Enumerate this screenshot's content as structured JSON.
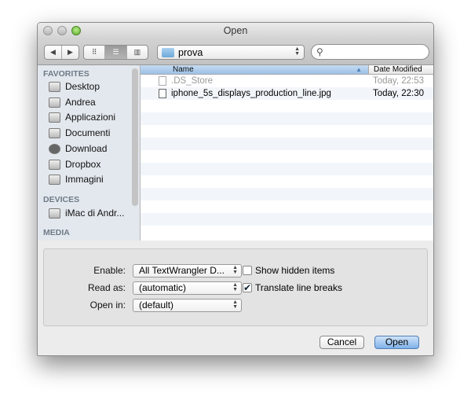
{
  "window": {
    "title": "Open"
  },
  "toolbar": {
    "back": "◀",
    "forward": "▶",
    "view_icon": "⠿",
    "view_list": "☰",
    "view_column": "▥",
    "path": "prova",
    "search_placeholder": "",
    "search_icon": "magnifier"
  },
  "sidebar": {
    "favorites_header": "FAVORITES",
    "favorites": [
      {
        "label": "Desktop",
        "icon": "desktop-icon"
      },
      {
        "label": "Andrea",
        "icon": "home-icon"
      },
      {
        "label": "Applicazioni",
        "icon": "applications-icon"
      },
      {
        "label": "Documenti",
        "icon": "documents-icon"
      },
      {
        "label": "Download",
        "icon": "download-icon"
      },
      {
        "label": "Dropbox",
        "icon": "folder-icon"
      },
      {
        "label": "Immagini",
        "icon": "camera-icon"
      }
    ],
    "devices_header": "DEVICES",
    "devices": [
      {
        "label": "iMac di Andr...",
        "icon": "imac-icon"
      }
    ],
    "media_header": "MEDIA"
  },
  "list": {
    "columns": [
      "Name",
      "Date Modified"
    ],
    "sort_indicator": "▲",
    "rows": [
      {
        "name": ".DS_Store",
        "date": "Today, 22:53",
        "dimmed": true
      },
      {
        "name": "iphone_5s_displays_production_line.jpg",
        "date": "Today, 22:30",
        "dimmed": false
      }
    ]
  },
  "options": {
    "enable_label": "Enable:",
    "enable_value": "All TextWrangler D...",
    "read_as_label": "Read as:",
    "read_as_value": "(automatic)",
    "open_in_label": "Open in:",
    "open_in_value": "(default)",
    "show_hidden_label": "Show hidden items",
    "show_hidden_checked": false,
    "translate_label": "Translate line breaks",
    "translate_checked": true,
    "check_mark": "✔"
  },
  "buttons": {
    "cancel": "Cancel",
    "open": "Open"
  },
  "colors": {
    "accent": "#7fb1ea",
    "sidebar": "#e3e8ee",
    "zebra": "#f2f6fb"
  }
}
